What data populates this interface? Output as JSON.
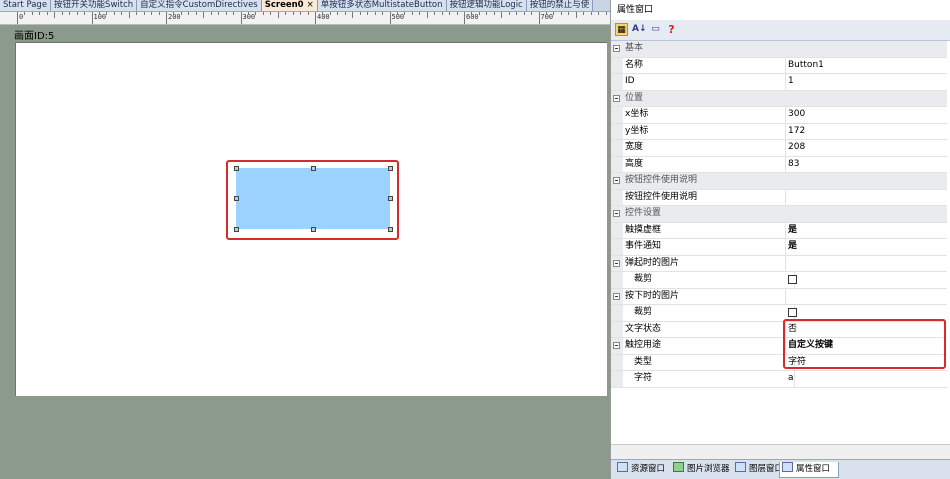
{
  "tabs": [
    {
      "label": "Start Page"
    },
    {
      "label": "按钮开关功能Switch"
    },
    {
      "label": "自定义指令CustomDirectives"
    },
    {
      "label": "Screen0",
      "close": "×"
    },
    {
      "label": "单按钮多状态MultistateButton"
    },
    {
      "label": "按钮逻辑功能Logic"
    },
    {
      "label": "按钮的禁止与使"
    }
  ],
  "ruler": {
    "labels": [
      "0",
      "100",
      "200",
      "300",
      "400",
      "500",
      "600",
      "700"
    ]
  },
  "screen": {
    "label": "画面ID:5"
  },
  "panel": {
    "title": "属性窗口",
    "toolbar": {
      "categorized": "▦",
      "alpha": "A↓",
      "pages": "▭",
      "help": "?"
    },
    "rows": [
      {
        "type": "cat",
        "key": "基本"
      },
      {
        "type": "prop",
        "key": "名称",
        "value": "Button1"
      },
      {
        "type": "prop",
        "key": "ID",
        "value": "1"
      },
      {
        "type": "cat",
        "key": "位置"
      },
      {
        "type": "prop",
        "key": "x坐标",
        "value": "300"
      },
      {
        "type": "prop",
        "key": "y坐标",
        "value": "172"
      },
      {
        "type": "prop",
        "key": "宽度",
        "value": "208"
      },
      {
        "type": "prop",
        "key": "高度",
        "value": "83"
      },
      {
        "type": "cat",
        "key": "按钮控件使用说明"
      },
      {
        "type": "prop",
        "key": "按钮控件使用说明",
        "value": ""
      },
      {
        "type": "cat",
        "key": "控件设置"
      },
      {
        "type": "prop",
        "key": "触摸虚框",
        "value": "是",
        "bold": true
      },
      {
        "type": "prop",
        "key": "事件通知",
        "value": "是",
        "bold": true
      },
      {
        "type": "group",
        "key": "弹起时的图片",
        "value": ""
      },
      {
        "type": "sub",
        "key": "裁剪",
        "checkbox": true
      },
      {
        "type": "group",
        "key": "按下时的图片",
        "value": ""
      },
      {
        "type": "sub",
        "key": "裁剪",
        "checkbox": true
      },
      {
        "type": "prop",
        "key": "文字状态",
        "value": "否"
      },
      {
        "type": "group",
        "key": "触控用途",
        "value": "自定义按键",
        "bold": true
      },
      {
        "type": "sub",
        "key": "类型",
        "value": "字符"
      },
      {
        "type": "sub",
        "key": "字符",
        "value": "a"
      }
    ],
    "bottom_tabs": [
      {
        "label": "资源窗口"
      },
      {
        "label": "图片浏览器"
      },
      {
        "label": "图层窗口"
      },
      {
        "label": "属性窗口"
      }
    ]
  },
  "colors": {
    "accent": "#d62b2b",
    "button": "#9bd2ff",
    "workspace": "#8b9a8b"
  }
}
